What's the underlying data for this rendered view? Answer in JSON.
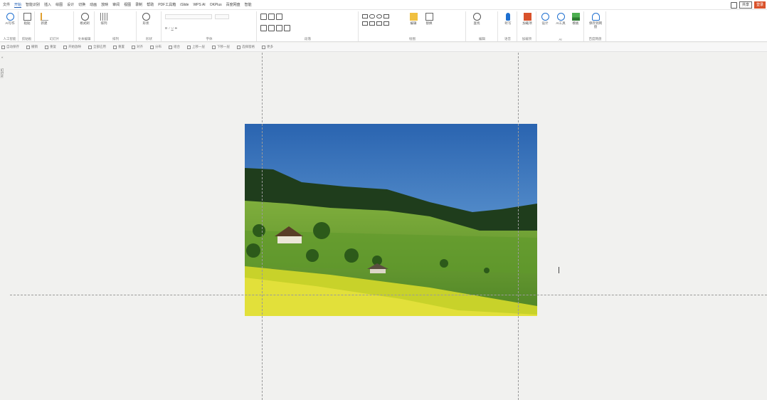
{
  "menubar": {
    "items": [
      "文件",
      "开始",
      "智能识别",
      "插入",
      "绘图",
      "设计",
      "切换",
      "动画",
      "放映",
      "审阅",
      "视图",
      "录制",
      "帮助",
      "PDF工具箱",
      "iSlide",
      "WPS AI",
      "OKPlus",
      "百度网盘",
      "智能"
    ],
    "active_index": 1,
    "share_label": "共享",
    "cta_label": "登录"
  },
  "ribbon": {
    "groups": [
      {
        "label": "人工智能",
        "buttons": [
          {
            "label": "AI写作",
            "icon": "ai-icon"
          }
        ]
      },
      {
        "label": "剪贴板",
        "buttons": [
          {
            "label": "粘贴",
            "icon": "paste-icon"
          }
        ]
      },
      {
        "label": "幻灯片",
        "buttons": [
          {
            "label": "新建",
            "icon": "new-slide-icon"
          }
        ]
      },
      {
        "label": "文本编辑",
        "buttons": [
          {
            "label": "格式刷",
            "icon": "brush-icon"
          }
        ]
      },
      {
        "label": "排列",
        "buttons": [
          {
            "label": "排列",
            "icon": "arrange-icon"
          }
        ]
      },
      {
        "label": "形状",
        "buttons": [
          {
            "label": "形状",
            "icon": "shape-icon"
          }
        ]
      },
      {
        "label": "字体",
        "buttons": []
      },
      {
        "label": "段落",
        "buttons": []
      },
      {
        "label": "绘图",
        "buttons": [
          {
            "label": "编辑",
            "icon": "edit-icon"
          },
          {
            "label": "替换",
            "icon": "replace-icon"
          }
        ]
      },
      {
        "label": "编辑",
        "buttons": [
          {
            "label": "查找",
            "icon": "find-icon"
          }
        ]
      },
      {
        "label": "语音",
        "buttons": [
          {
            "label": "听写",
            "icon": "mic-icon"
          }
        ]
      },
      {
        "label": "加载项",
        "buttons": [
          {
            "label": "加载项",
            "icon": "addin-icon"
          }
        ]
      },
      {
        "label": "AI",
        "buttons": [
          {
            "label": "设计",
            "icon": "designer-icon"
          },
          {
            "label": "AI工具",
            "icon": "ai-tools-icon"
          },
          {
            "label": "模板",
            "icon": "template-icon"
          }
        ]
      },
      {
        "label": "百度网盘",
        "buttons": [
          {
            "label": "保存到网盘",
            "icon": "cloud-drive-icon"
          }
        ]
      }
    ]
  },
  "toolbar2": {
    "items": [
      "自动保存",
      "撤销",
      "重复",
      "开始放映",
      "全部应用",
      "重置",
      "对齐",
      "分布",
      "组合",
      "上移一层",
      "下移一层",
      "选择窗格",
      "更多"
    ]
  },
  "sidebar": {
    "mark_top": "«",
    "slide_label": "幻灯片"
  },
  "canvas": {
    "image_alt": "green hillside landscape with farmhouse and forest"
  }
}
